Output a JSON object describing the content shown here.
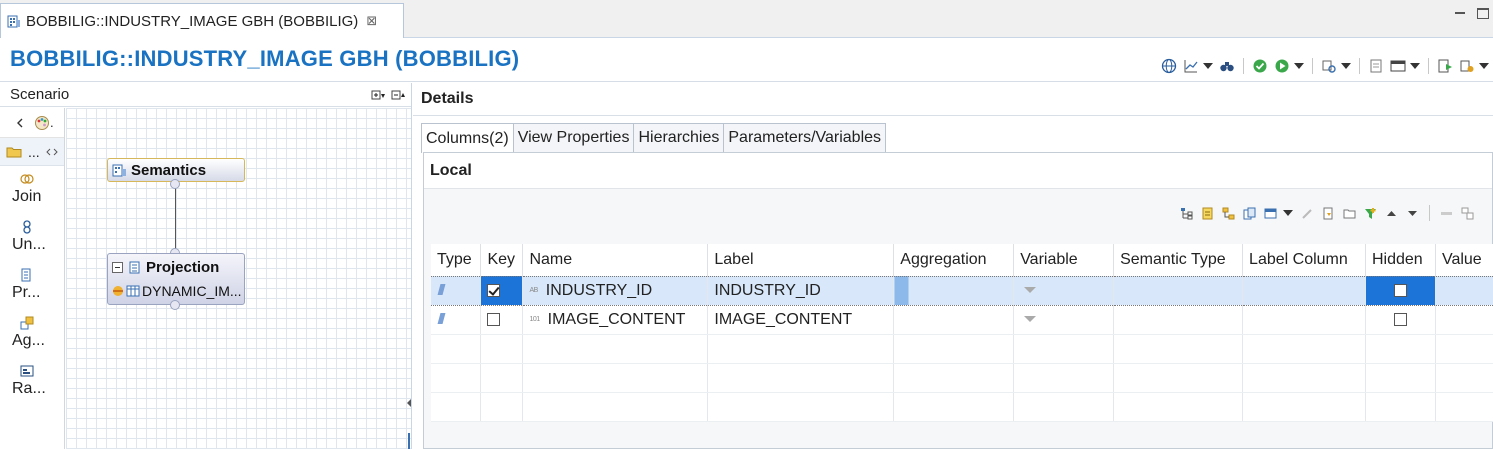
{
  "editor_tab": {
    "label": "BOBBILIG::INDUSTRY_IMAGE GBH (BOBBILIG)",
    "close": "⊠"
  },
  "page_title": "BOBBILIG::INDUSTRY_IMAGE GBH (BOBBILIG)",
  "colors": {
    "title": "#1a73c2",
    "selection": "#1c74d8",
    "row_selected": "#d8e8fa"
  },
  "scenario": {
    "title": "Scenario",
    "palette_items": [
      {
        "label": "Join",
        "icon": "join-icon"
      },
      {
        "label": "Un...",
        "icon": "union-icon"
      },
      {
        "label": "Pr...",
        "icon": "projection-icon"
      },
      {
        "label": "Ag...",
        "icon": "aggregation-icon"
      },
      {
        "label": "Ra...",
        "icon": "rank-icon"
      }
    ],
    "palette_tool_label": "...",
    "palette_pointer_label": ".",
    "nodes": {
      "semantics": "Semantics",
      "projection": "Projection",
      "projection_source": "DYNAMIC_IM..."
    }
  },
  "details": {
    "title": "Details",
    "tabs": [
      "Columns(2)",
      "View Properties",
      "Hierarchies",
      "Parameters/Variables"
    ],
    "local_title": "Local",
    "columns": [
      "Type",
      "Key",
      "Name",
      "Label",
      "Aggregation",
      "Variable",
      "Semantic Type",
      "Label Column",
      "Hidden",
      "Value"
    ],
    "rows": [
      {
        "key": true,
        "datatype": "AB",
        "name": "INDUSTRY_ID",
        "label": "INDUSTRY_ID",
        "hidden": false,
        "selected": true
      },
      {
        "key": false,
        "datatype": "101",
        "name": "IMAGE_CONTENT",
        "label": "IMAGE_CONTENT",
        "hidden": false,
        "selected": false
      }
    ]
  }
}
